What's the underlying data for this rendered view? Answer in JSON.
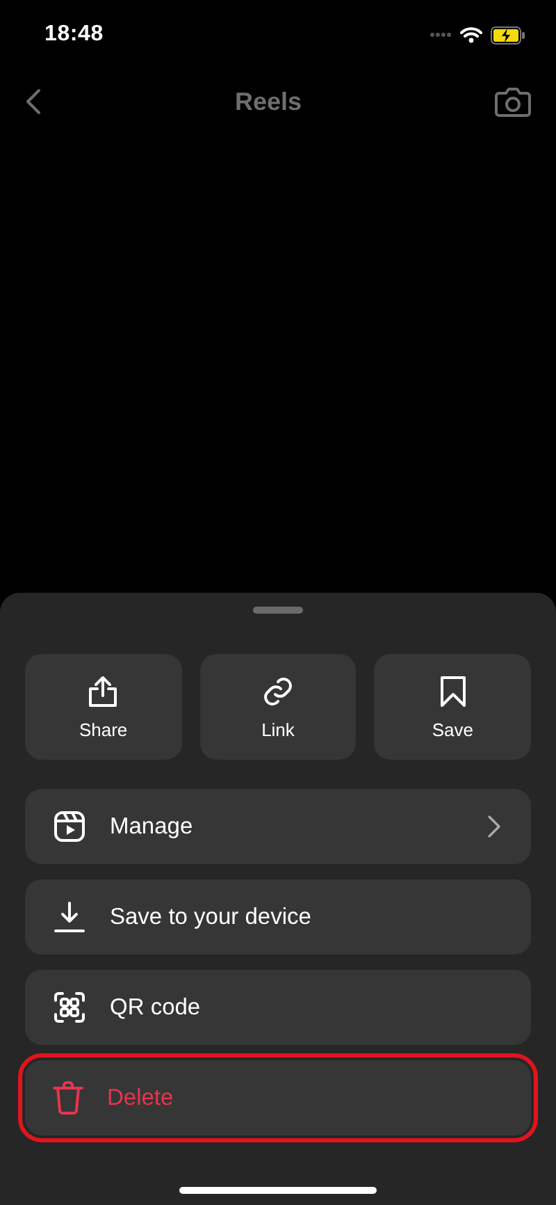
{
  "status_bar": {
    "time": "18:48",
    "battery_charging": true
  },
  "header": {
    "title": "Reels"
  },
  "sheet": {
    "tiles": [
      {
        "label": "Share"
      },
      {
        "label": "Link"
      },
      {
        "label": "Save"
      }
    ],
    "items": [
      {
        "label": "Manage",
        "has_chevron": true,
        "destructive": false,
        "highlighted": false
      },
      {
        "label": "Save to your device",
        "has_chevron": false,
        "destructive": false,
        "highlighted": false
      },
      {
        "label": "QR code",
        "has_chevron": false,
        "destructive": false,
        "highlighted": false
      },
      {
        "label": "Delete",
        "has_chevron": false,
        "destructive": true,
        "highlighted": true
      }
    ]
  }
}
